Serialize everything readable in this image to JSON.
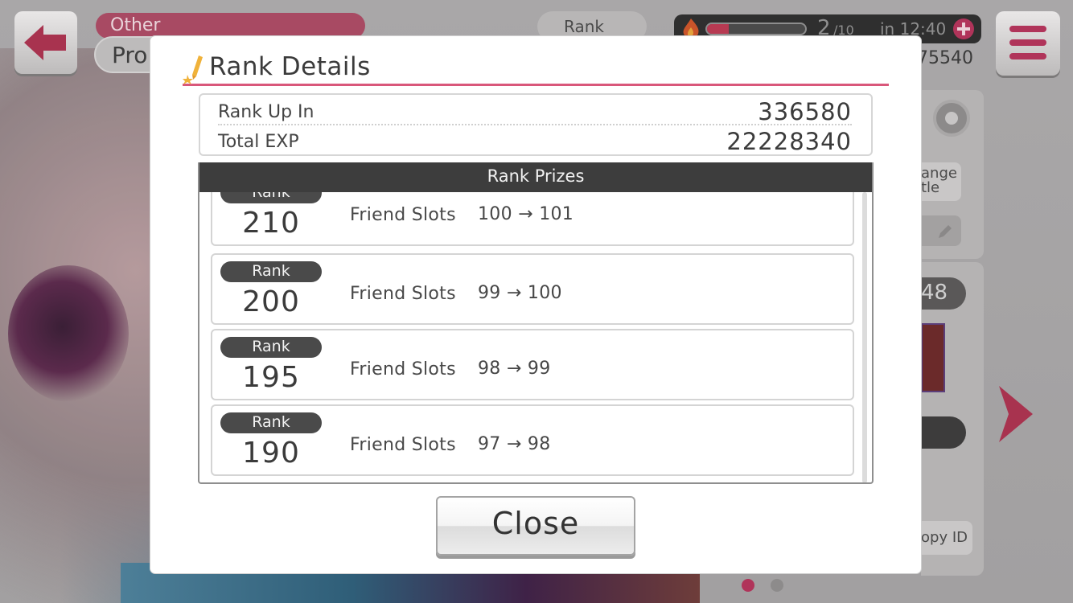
{
  "background": {
    "tab_other": "Other",
    "tab_profile": "Pro",
    "rank_chip": "Rank",
    "stamina_value": "2",
    "stamina_max": "/10",
    "stamina_timer": "in 12:40",
    "stamina_fill_fraction": 0.22,
    "coins": "75540",
    "change_title": "ange\ntle",
    "id_partial": "48",
    "copy_id": "opy ID",
    "icons": [
      "back-arrow-icon",
      "flame-icon",
      "plus-icon",
      "menu-icon",
      "gear-icon",
      "pencil-icon",
      "next-arrow-icon"
    ],
    "page_dots": {
      "count": 2,
      "active_index": 0,
      "active_color": "#b0345a",
      "inactive_color": "#8d8b8b"
    }
  },
  "modal": {
    "title": "Rank Details",
    "title_icon": "pencil-star-icon",
    "accent_color": "#d9577a",
    "stats": {
      "rank_up_label": "Rank Up In",
      "rank_up_value": "336580",
      "total_exp_label": "Total EXP",
      "total_exp_value": "22228340"
    },
    "prizes": {
      "header": "Rank Prizes",
      "items": [
        {
          "rank_label": "Rank",
          "rank": "210",
          "prize": "Friend Slots",
          "change": "100 → 101"
        },
        {
          "rank_label": "Rank",
          "rank": "200",
          "prize": "Friend Slots",
          "change": "99 → 100"
        },
        {
          "rank_label": "Rank",
          "rank": "195",
          "prize": "Friend Slots",
          "change": "98 → 99"
        },
        {
          "rank_label": "Rank",
          "rank": "190",
          "prize": "Friend Slots",
          "change": "97 → 98"
        }
      ]
    },
    "close_label": "Close"
  }
}
